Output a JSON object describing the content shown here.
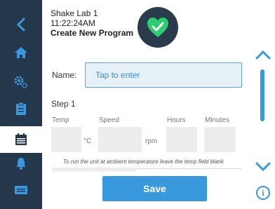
{
  "header": {
    "device_name": "Shake Lab 1",
    "time": "11:22:24AM",
    "screen_title": "Create New Program"
  },
  "nav": {
    "items": [
      {
        "icon": "back-chevron-icon"
      },
      {
        "icon": "home-icon"
      },
      {
        "icon": "settings-gears-icon"
      },
      {
        "icon": "clipboard-icon"
      },
      {
        "icon": "calendar-list-icon",
        "active": true
      },
      {
        "icon": "alarm-bell-icon"
      },
      {
        "icon": "card-icon"
      }
    ]
  },
  "status": {
    "icon": "check-heart-icon",
    "color": "#2ecc71"
  },
  "name": {
    "label": "Name:",
    "placeholder": "Tap to enter"
  },
  "step": {
    "title": "Step 1",
    "columns": {
      "temp": "Temp",
      "speed": "Speed",
      "hours": "Hours",
      "minutes": "Minutes"
    },
    "units": {
      "temp": "°C",
      "speed": "rpm"
    },
    "hint": "To run the unit at ambient temperature leave the temp field blank"
  },
  "actions": {
    "save_label": "Save"
  },
  "info": {
    "glyph": "i"
  },
  "colors": {
    "accent": "#3a98dc",
    "nav_bg": "#25384b",
    "status_ok": "#2ecc71"
  }
}
